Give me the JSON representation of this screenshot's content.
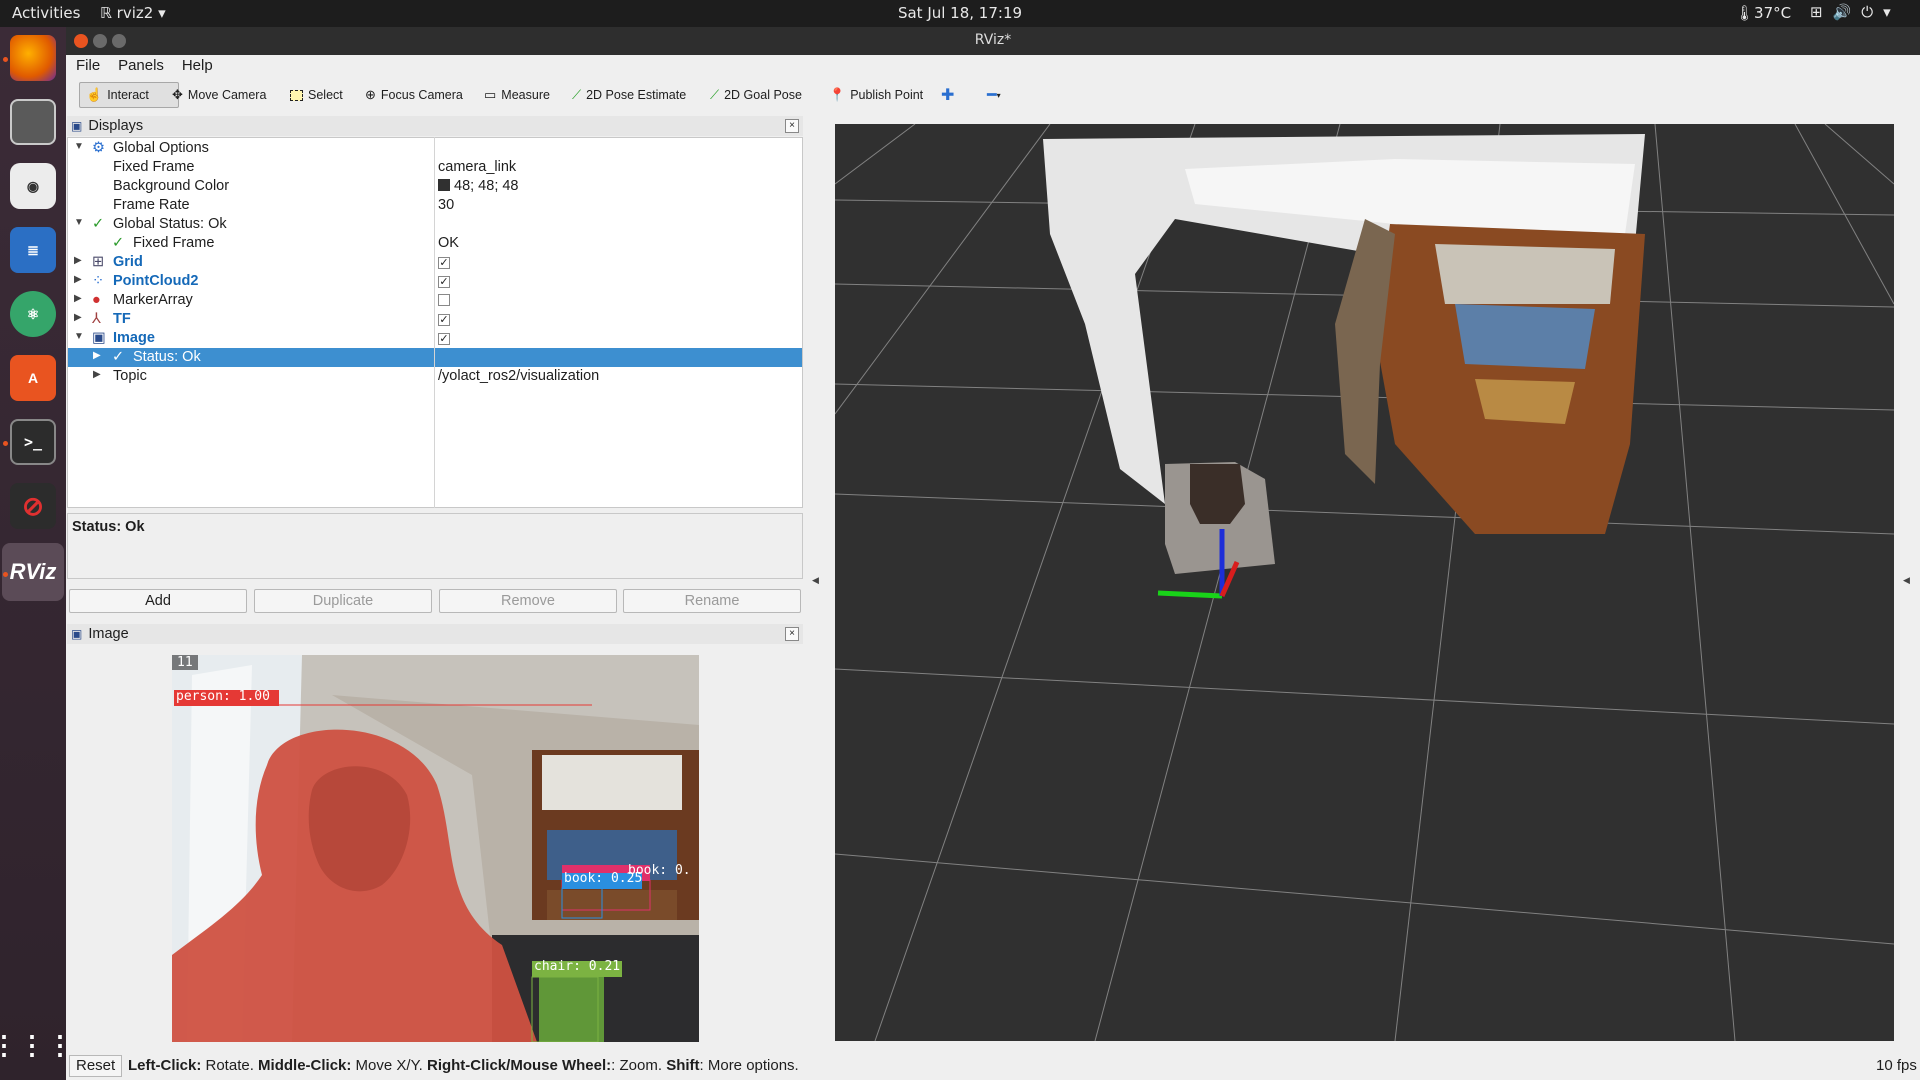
{
  "system_bar": {
    "activities": "Activities",
    "app_name": "rviz2",
    "clock": "Sat Jul 18, 17:19",
    "temperature": "37°C"
  },
  "window": {
    "title": "RViz*"
  },
  "menu": {
    "file": "File",
    "panels": "Panels",
    "help": "Help"
  },
  "toolbar": {
    "interact": "Interact",
    "move_camera": "Move Camera",
    "select": "Select",
    "focus_camera": "Focus Camera",
    "measure": "Measure",
    "pose_estimate": "2D Pose Estimate",
    "goal_pose": "2D Goal Pose",
    "publish_point": "Publish Point"
  },
  "displays_panel": {
    "title": "Displays",
    "rows": [
      {
        "label": "Global Options",
        "value": ""
      },
      {
        "label": "Fixed Frame",
        "value": "camera_link"
      },
      {
        "label": "Background Color",
        "value": "48; 48; 48"
      },
      {
        "label": "Frame Rate",
        "value": "30"
      },
      {
        "label": "Global Status: Ok",
        "value": ""
      },
      {
        "label": "Fixed Frame",
        "value": "OK"
      },
      {
        "label": "Grid",
        "value": "",
        "checked": true
      },
      {
        "label": "PointCloud2",
        "value": "",
        "checked": true
      },
      {
        "label": "MarkerArray",
        "value": "",
        "checked": false
      },
      {
        "label": "TF",
        "value": "",
        "checked": true
      },
      {
        "label": "Image",
        "value": "",
        "checked": true
      },
      {
        "label": "Status: Ok",
        "value": ""
      },
      {
        "label": "Topic",
        "value": "/yolact_ros2/visualization"
      }
    ],
    "status_text": "Status: Ok",
    "buttons": {
      "add": "Add",
      "duplicate": "Duplicate",
      "remove": "Remove",
      "rename": "Rename"
    }
  },
  "image_panel": {
    "title": "Image",
    "frame_tag": "11",
    "detections": [
      "person: 1.00",
      "book: 0.25",
      "book: 0.",
      "chair: 0.21"
    ]
  },
  "statusbar": {
    "reset": "Reset",
    "left_click_key": "Left-Click:",
    "left_click_val": " Rotate. ",
    "middle_click_key": "Middle-Click:",
    "middle_click_val": " Move X/Y. ",
    "right_click_key": "Right-Click/Mouse Wheel:",
    "right_click_val": ": Zoom. ",
    "shift_key": "Shift",
    "shift_val": ": More options.",
    "fps": "10 fps"
  },
  "colors": {
    "background": "#303030",
    "selection": "#3d8fd0",
    "accent": "#e95420"
  }
}
